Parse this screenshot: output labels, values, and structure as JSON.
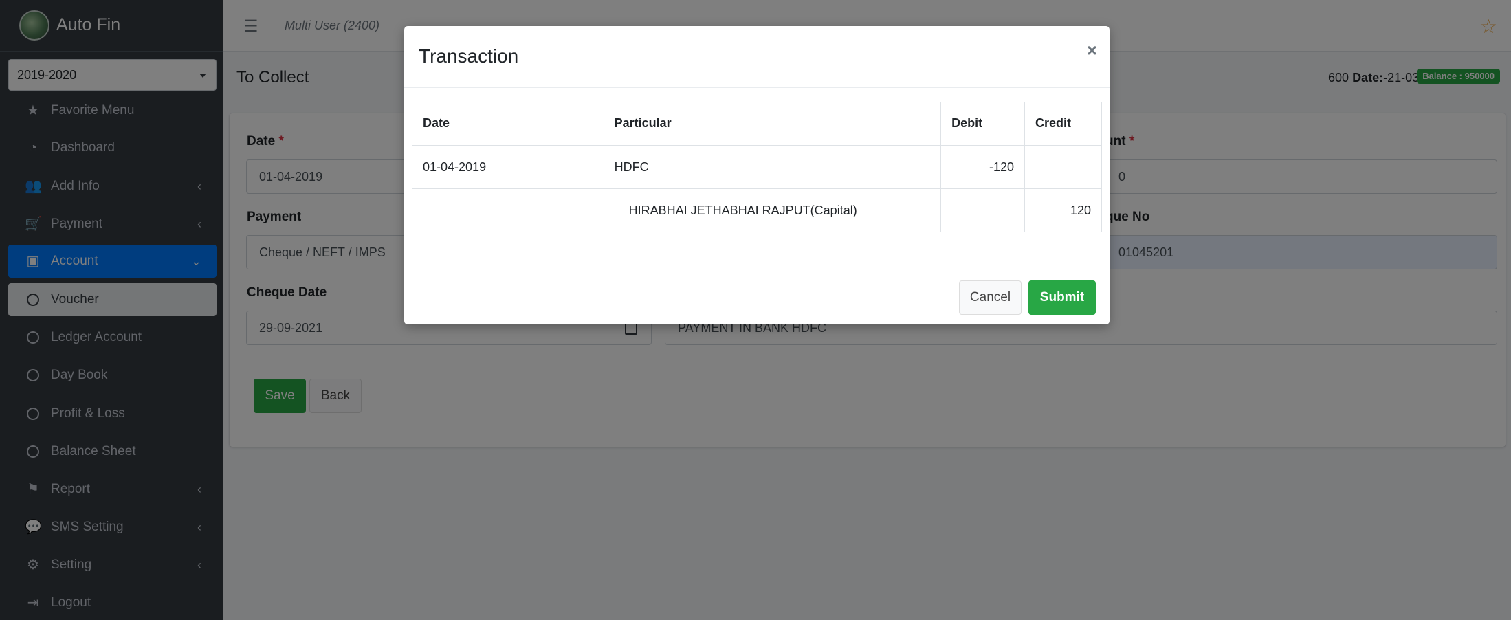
{
  "brand": {
    "name": "Auto Fin"
  },
  "sidebar": {
    "year": "2019-2020",
    "items": [
      {
        "label": "Favorite Menu",
        "icon": "star-icon"
      },
      {
        "label": "Dashboard",
        "icon": "dashboard-icon"
      },
      {
        "label": "Add Info",
        "icon": "users-icon"
      },
      {
        "label": "Payment",
        "icon": "cart-icon"
      },
      {
        "label": "Account",
        "icon": "money-icon"
      },
      {
        "label": "Voucher",
        "icon": "circle-icon"
      },
      {
        "label": "Ledger Account",
        "icon": "circle-icon"
      },
      {
        "label": "Day Book",
        "icon": "circle-icon"
      },
      {
        "label": "Profit & Loss",
        "icon": "circle-icon"
      },
      {
        "label": "Balance Sheet",
        "icon": "circle-icon"
      },
      {
        "label": "Report",
        "icon": "flag-icon"
      },
      {
        "label": "SMS Setting",
        "icon": "chat-icon"
      },
      {
        "label": "Setting",
        "icon": "cogs-icon"
      },
      {
        "label": "Logout",
        "icon": "logout-icon"
      }
    ]
  },
  "topbar": {
    "user": "Multi User (2400)"
  },
  "header": {
    "title": "To Collect",
    "info_prefix": "600",
    "date_label": "Date:",
    "date_value": "-21-03-2020",
    "balance": "Balance : 950000"
  },
  "form": {
    "date_label": "Date",
    "date_value": "01-04-2019",
    "amount_label": "unt",
    "amount_value": "0",
    "payment_label": "Payment",
    "payment_value": "Cheque / NEFT / IMPS",
    "cheque_no_label": "que No",
    "cheque_no_value": "01045201",
    "cheque_date_label": "Cheque Date",
    "cheque_date_value": "29-09-2021",
    "remark_value": "PAYMENT IN BANK HDFC",
    "save_label": "Save",
    "back_label": "Back"
  },
  "modal": {
    "title": "Transaction",
    "close": "×",
    "columns": [
      "Date",
      "Particular",
      "Debit",
      "Credit"
    ],
    "rows": [
      {
        "date": "01-04-2019",
        "particular": "HDFC",
        "debit": "-120",
        "credit": ""
      },
      {
        "date": "",
        "particular": "HIRABHAI JETHABHAI RAJPUT(Capital)",
        "debit": "",
        "credit": "120"
      }
    ],
    "cancel_label": "Cancel",
    "submit_label": "Submit"
  },
  "colors": {
    "sidebar_bg": "#343a40",
    "active_blue": "#007bff",
    "success_green": "#28a745"
  }
}
